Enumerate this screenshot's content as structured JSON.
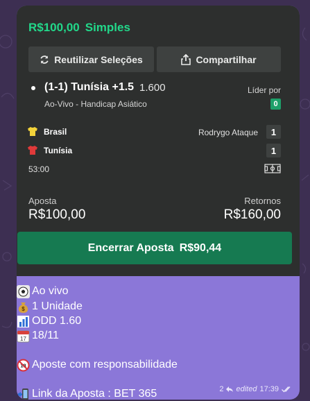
{
  "bet": {
    "stake_header": "R$100,00",
    "type": "Simples",
    "reuse_label": "Reutilizar Seleções",
    "share_label": "Compartilhar",
    "selection_title": "(1-1) Tunísia +1.5",
    "selection_odd": "1.600",
    "market": "Ao-Vivo - Handicap Asiático",
    "leader_label": "Líder por",
    "leader_value": "0",
    "teams": [
      {
        "name": "Brasil",
        "score": "1",
        "scorer": "Rodrygo Ataque"
      },
      {
        "name": "Tunísia",
        "score": "1"
      }
    ],
    "match_clock": "53:00",
    "stake_label": "Aposta",
    "stake_value": "R$100,00",
    "returns_label": "Retornos",
    "returns_value": "R$160,00",
    "cashout_label": "Encerrar Aposta",
    "cashout_value": "R$90,44"
  },
  "message": {
    "lines": [
      "Ao vivo",
      "1 Unidade",
      "ODD 1.60",
      "18/11",
      "Aposte com responsabilidade",
      "Link da Aposta : BET 365"
    ],
    "reactions_count": "2",
    "edited_label": "edited",
    "time": "17:39"
  },
  "colors": {
    "accent_green": "#22d88a",
    "cashout_green": "#167a51",
    "bubble_purple": "#8b77d8"
  },
  "icons": [
    "soccer-ball-icon",
    "money-bag-icon",
    "bar-chart-icon",
    "calendar-icon",
    "no-under-18-icon",
    "phone-arrow-icon",
    "reply-arrow-icon",
    "double-check-icon",
    "refresh-icon",
    "share-icon",
    "pitch-icon"
  ]
}
